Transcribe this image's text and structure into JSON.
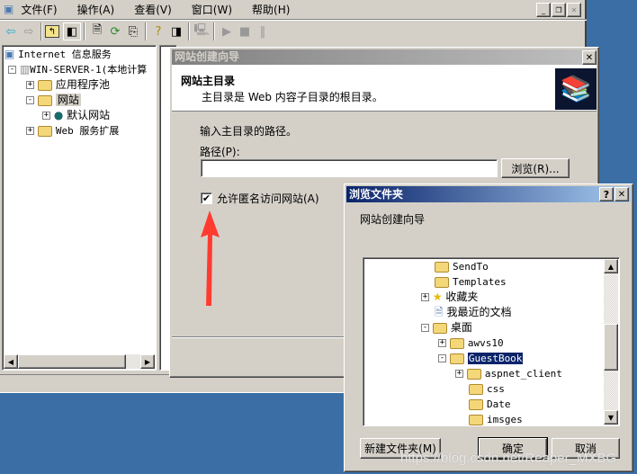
{
  "main_window": {
    "menu": [
      "文件(F)",
      "操作(A)",
      "查看(V)",
      "窗口(W)",
      "帮助(H)"
    ],
    "toolbar_icons": [
      "back-icon",
      "forward-icon",
      "up-folder-icon",
      "show-tree-icon",
      "properties-icon",
      "refresh-icon",
      "export-icon",
      "help-icon",
      "action-pane-icon",
      "computer-icon",
      "play-icon",
      "stop-icon",
      "pause-icon"
    ],
    "tree": [
      {
        "label": "Internet 信息服务",
        "level": 0
      },
      {
        "label": "WIN-SERVER-1(本地计算",
        "level": 1,
        "expanded": true
      },
      {
        "label": "应用程序池",
        "level": 2
      },
      {
        "label": "网站",
        "level": 2,
        "expanded": true,
        "selected": true
      },
      {
        "label": "默认网站",
        "level": 3
      },
      {
        "label": "Web 服务扩展",
        "level": 2
      }
    ]
  },
  "wizard": {
    "title": "网站创建向导",
    "heading": "网站主目录",
    "subheading": "主目录是 Web 内容子目录的根目录。",
    "instruction": "输入主目录的路径。",
    "path_label": "路径(P):",
    "path_value": "",
    "browse_button": "浏览(R)...",
    "anonymous_checkbox": {
      "label": "允许匿名访问网站(A)",
      "checked": true
    }
  },
  "browse_dialog": {
    "title": "浏览文件夹",
    "description": "网站创建向导",
    "tree": [
      {
        "label": "SendTo",
        "icon": "folder-icon"
      },
      {
        "label": "Templates",
        "icon": "folder-icon"
      },
      {
        "label": "收藏夹",
        "icon": "star-icon",
        "expander": "+"
      },
      {
        "label": "我最近的文档",
        "icon": "recent-docs-icon"
      },
      {
        "label": "桌面",
        "icon": "folder-icon",
        "expander": "-"
      },
      {
        "label": "awvs10",
        "icon": "folder-icon",
        "expander": "+"
      },
      {
        "label": "GuestBook",
        "icon": "folder-open-icon",
        "expander": "-",
        "selected": true
      },
      {
        "label": "aspnet_client",
        "icon": "folder-icon",
        "expander": "+"
      },
      {
        "label": "css",
        "icon": "folder-icon"
      },
      {
        "label": "Date",
        "icon": "folder-icon"
      },
      {
        "label": "imsges",
        "icon": "folder-icon"
      }
    ],
    "new_folder_button": "新建文件夹(M)",
    "ok_button": "确定",
    "cancel_button": "取消"
  },
  "watermark": "https://blog.csdn.net/Reaper_MXBG",
  "colors": {
    "desktop": "#3a6ea5",
    "active_title": "#0a246a",
    "inactive_title": "#808080",
    "annotation_arrow": "#ff3b30"
  }
}
